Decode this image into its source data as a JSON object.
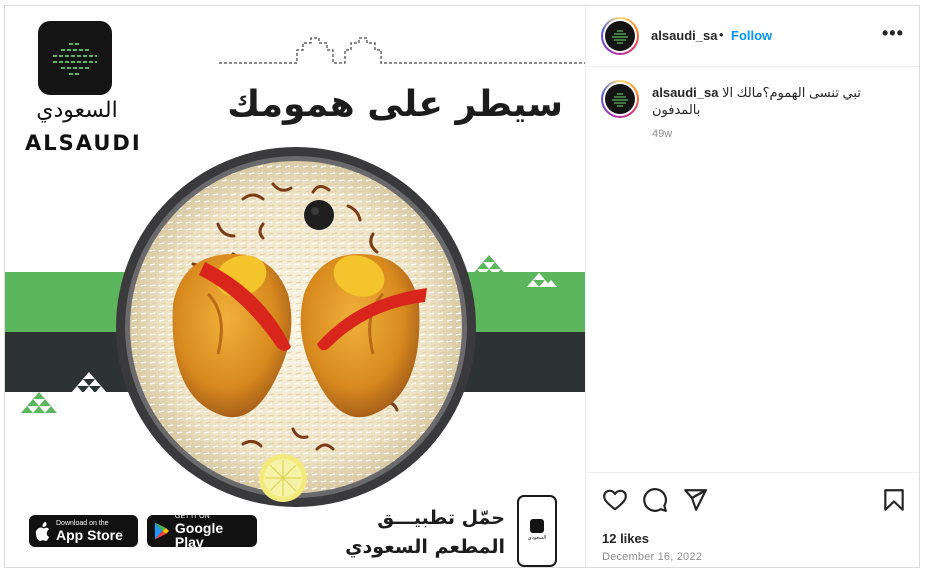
{
  "post_image": {
    "logo_arabic": "السعودي",
    "logo_english": "ALSAUDI",
    "headline": "سيطر على همومك",
    "cta_line1": "حمّل تطبيـــق",
    "cta_line2": "المطعم السعودي",
    "app_store": {
      "small": "Download on the",
      "big": "App Store",
      "icon": "apple-icon"
    },
    "google_play": {
      "small": "GET IT ON",
      "big": "Google Play",
      "icon": "play-icon"
    },
    "phone_label": "السعودي"
  },
  "header": {
    "username": "alsaudi_sa",
    "separator": "•",
    "follow_label": "Follow",
    "more_label": "•••"
  },
  "caption": {
    "username": "alsaudi_sa",
    "text": "تبي تنسى الهموم؟مالك الا بالمدفون",
    "time_ago": "49w"
  },
  "actions": {
    "icons": [
      "heart-icon",
      "comment-icon",
      "share-icon",
      "bookmark-icon"
    ],
    "likes": "12 likes",
    "date": "December 16, 2022"
  },
  "colors": {
    "brand_green": "#5bb65e",
    "band_dark": "#2d3333",
    "follow_blue": "#0095f6",
    "muted": "#8e8e8e"
  }
}
